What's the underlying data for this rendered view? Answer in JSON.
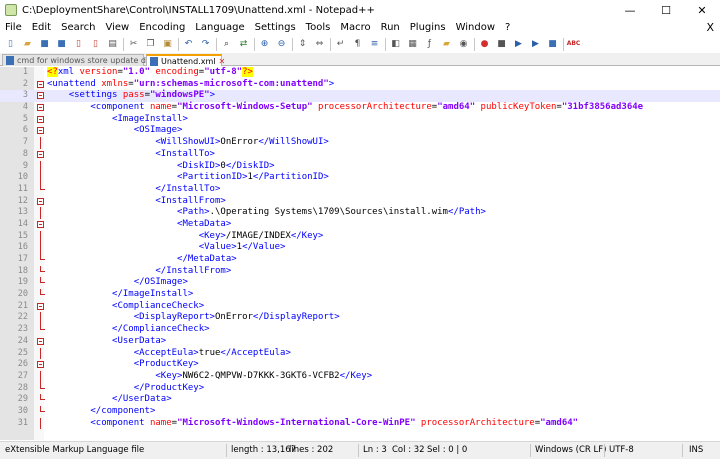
{
  "window": {
    "title": "C:\\DeploymentShare\\Control\\INSTALL1709\\Unattend.xml - Notepad++",
    "minimize_glyph": "—",
    "maximize_glyph": "☐",
    "close_glyph": "✕"
  },
  "menu": {
    "items": [
      "File",
      "Edit",
      "Search",
      "View",
      "Encoding",
      "Language",
      "Settings",
      "Tools",
      "Macro",
      "Run",
      "Plugins",
      "Window",
      "?"
    ],
    "close_glyph": "X"
  },
  "toolbar": {
    "buttons": [
      {
        "icon": "new-file-icon",
        "glyph": "▯",
        "color": "#4a7fc1"
      },
      {
        "icon": "open-file-icon",
        "glyph": "▰",
        "color": "#d8a63a"
      },
      {
        "icon": "save-icon",
        "glyph": "■",
        "color": "#3b6fb6"
      },
      {
        "icon": "save-all-icon",
        "glyph": "■",
        "color": "#3b6fb6"
      },
      {
        "icon": "close-icon",
        "glyph": "▯",
        "color": "#c8453d"
      },
      {
        "icon": "close-all-icon",
        "glyph": "▯",
        "color": "#c8453d"
      },
      {
        "icon": "print-icon",
        "glyph": "▤",
        "color": "#555555"
      },
      {
        "sep": true
      },
      {
        "icon": "cut-icon",
        "glyph": "✂",
        "color": "#555555"
      },
      {
        "icon": "copy-icon",
        "glyph": "❐",
        "color": "#555555"
      },
      {
        "icon": "paste-icon",
        "glyph": "▣",
        "color": "#b38a36"
      },
      {
        "sep": true
      },
      {
        "icon": "undo-icon",
        "glyph": "↶",
        "color": "#2b5fa8"
      },
      {
        "icon": "redo-icon",
        "glyph": "↷",
        "color": "#2b5fa8"
      },
      {
        "sep": true
      },
      {
        "icon": "find-icon",
        "glyph": "⌕",
        "color": "#333333"
      },
      {
        "icon": "replace-icon",
        "glyph": "⇄",
        "color": "#2f7d32"
      },
      {
        "sep": true
      },
      {
        "icon": "zoom-in-icon",
        "glyph": "⊕",
        "color": "#2b5fa8"
      },
      {
        "icon": "zoom-out-icon",
        "glyph": "⊖",
        "color": "#2b5fa8"
      },
      {
        "sep": true
      },
      {
        "icon": "sync-vertical-icon",
        "glyph": "⇕",
        "color": "#555555"
      },
      {
        "icon": "sync-horizontal-icon",
        "glyph": "⇔",
        "color": "#555555"
      },
      {
        "sep": true
      },
      {
        "icon": "word-wrap-icon",
        "glyph": "↵",
        "color": "#555555"
      },
      {
        "icon": "show-all-chars-icon",
        "glyph": "¶",
        "color": "#555555"
      },
      {
        "icon": "indent-guide-icon",
        "glyph": "≡",
        "color": "#2b5fa8"
      },
      {
        "sep": true
      },
      {
        "icon": "user-language-icon",
        "glyph": "◧",
        "color": "#555555"
      },
      {
        "icon": "doc-map-icon",
        "glyph": "▦",
        "color": "#555555"
      },
      {
        "icon": "function-list-icon",
        "glyph": "ƒ",
        "color": "#555555"
      },
      {
        "icon": "folder-workspace-icon",
        "glyph": "▰",
        "color": "#d8a63a"
      },
      {
        "icon": "monitoring-icon",
        "glyph": "◉",
        "color": "#555555"
      },
      {
        "sep": true
      },
      {
        "icon": "record-macro-icon",
        "glyph": "●",
        "color": "#d32f2f"
      },
      {
        "icon": "stop-record-icon",
        "glyph": "■",
        "color": "#555555"
      },
      {
        "icon": "play-macro-icon",
        "glyph": "▶",
        "color": "#2b5fa8"
      },
      {
        "icon": "run-macro-multiple-icon",
        "glyph": "▶",
        "color": "#2b5fa8"
      },
      {
        "icon": "save-macro-icon",
        "glyph": "■",
        "color": "#3b6fb6"
      },
      {
        "sep": true
      },
      {
        "icon": "spell-check-icon",
        "glyph": "ABC",
        "color": "#c62828"
      }
    ]
  },
  "tabs": [
    {
      "label": "cmd for windows store update disable.txt",
      "active": false
    },
    {
      "label": "Unattend.xml",
      "active": true
    }
  ],
  "editor": {
    "current_line": 3,
    "lines": [
      {
        "n": "1",
        "fold": "none",
        "segs": [
          [
            "decl",
            "<?"
          ],
          [
            "tag",
            "xml "
          ],
          [
            "attr",
            "version"
          ],
          [
            "text",
            "="
          ],
          [
            "val",
            "\"1.0\""
          ],
          [
            "text",
            " "
          ],
          [
            "attr",
            "encoding"
          ],
          [
            "text",
            "="
          ],
          [
            "val",
            "\"utf-8\""
          ],
          [
            "decl",
            "?>"
          ]
        ]
      },
      {
        "n": "2",
        "fold": "box",
        "segs": [
          [
            "tag",
            "<unattend "
          ],
          [
            "attr",
            "xmlns"
          ],
          [
            "text",
            "="
          ],
          [
            "val",
            "\"urn:schemas-microsoft-com:unattend\""
          ],
          [
            "tag",
            ">"
          ]
        ]
      },
      {
        "n": "3",
        "fold": "box",
        "segs": [
          [
            "text",
            "    "
          ],
          [
            "tag",
            "<settings "
          ],
          [
            "attr",
            "pass"
          ],
          [
            "text",
            "="
          ],
          [
            "val",
            "\"windowsPE\""
          ],
          [
            "tag",
            ">"
          ]
        ]
      },
      {
        "n": "4",
        "fold": "box",
        "segs": [
          [
            "text",
            "        "
          ],
          [
            "tag",
            "<component "
          ],
          [
            "attr",
            "name"
          ],
          [
            "text",
            "="
          ],
          [
            "val",
            "\"Microsoft-Windows-Setup\""
          ],
          [
            "text",
            " "
          ],
          [
            "attr",
            "processorArchitecture"
          ],
          [
            "text",
            "="
          ],
          [
            "val",
            "\"amd64\""
          ],
          [
            "text",
            " "
          ],
          [
            "attr",
            "publicKeyToken"
          ],
          [
            "text",
            "="
          ],
          [
            "val",
            "\"31bf3856ad364e"
          ]
        ]
      },
      {
        "n": "5",
        "fold": "box",
        "segs": [
          [
            "text",
            "            "
          ],
          [
            "tag",
            "<ImageInstall>"
          ]
        ]
      },
      {
        "n": "6",
        "fold": "box",
        "segs": [
          [
            "text",
            "                "
          ],
          [
            "tag",
            "<OSImage>"
          ]
        ]
      },
      {
        "n": "7",
        "fold": "vline",
        "segs": [
          [
            "text",
            "                    "
          ],
          [
            "tag",
            "<WillShowUI>"
          ],
          [
            "text",
            "OnError"
          ],
          [
            "tag",
            "</WillShowUI>"
          ]
        ]
      },
      {
        "n": "8",
        "fold": "box",
        "segs": [
          [
            "text",
            "                    "
          ],
          [
            "tag",
            "<InstallTo>"
          ]
        ]
      },
      {
        "n": "9",
        "fold": "vline",
        "segs": [
          [
            "text",
            "                        "
          ],
          [
            "tag",
            "<DiskID>"
          ],
          [
            "text",
            "0"
          ],
          [
            "tag",
            "</DiskID>"
          ]
        ]
      },
      {
        "n": "10",
        "fold": "vline",
        "segs": [
          [
            "text",
            "                        "
          ],
          [
            "tag",
            "<PartitionID>"
          ],
          [
            "text",
            "1"
          ],
          [
            "tag",
            "</PartitionID>"
          ]
        ]
      },
      {
        "n": "11",
        "fold": "end",
        "segs": [
          [
            "text",
            "                    "
          ],
          [
            "tag",
            "</InstallTo>"
          ]
        ]
      },
      {
        "n": "12",
        "fold": "box",
        "segs": [
          [
            "text",
            "                    "
          ],
          [
            "tag",
            "<InstallFrom>"
          ]
        ]
      },
      {
        "n": "13",
        "fold": "vline",
        "segs": [
          [
            "text",
            "                        "
          ],
          [
            "tag",
            "<Path>"
          ],
          [
            "text",
            ".\\Operating Systems\\1709\\Sources\\install.wim"
          ],
          [
            "tag",
            "</Path>"
          ]
        ]
      },
      {
        "n": "14",
        "fold": "box",
        "segs": [
          [
            "text",
            "                        "
          ],
          [
            "tag",
            "<MetaData>"
          ]
        ]
      },
      {
        "n": "15",
        "fold": "vline",
        "segs": [
          [
            "text",
            "                            "
          ],
          [
            "tag",
            "<Key>"
          ],
          [
            "text",
            "/IMAGE/INDEX"
          ],
          [
            "tag",
            "</Key>"
          ]
        ]
      },
      {
        "n": "16",
        "fold": "vline",
        "segs": [
          [
            "text",
            "                            "
          ],
          [
            "tag",
            "<Value>"
          ],
          [
            "text",
            "1"
          ],
          [
            "tag",
            "</Value>"
          ]
        ]
      },
      {
        "n": "17",
        "fold": "end",
        "segs": [
          [
            "text",
            "                        "
          ],
          [
            "tag",
            "</MetaData>"
          ]
        ]
      },
      {
        "n": "18",
        "fold": "end",
        "segs": [
          [
            "text",
            "                    "
          ],
          [
            "tag",
            "</InstallFrom>"
          ]
        ]
      },
      {
        "n": "19",
        "fold": "end",
        "segs": [
          [
            "text",
            "                "
          ],
          [
            "tag",
            "</OSImage>"
          ]
        ]
      },
      {
        "n": "20",
        "fold": "end",
        "segs": [
          [
            "text",
            "            "
          ],
          [
            "tag",
            "</ImageInstall>"
          ]
        ]
      },
      {
        "n": "21",
        "fold": "box",
        "segs": [
          [
            "text",
            "            "
          ],
          [
            "tag",
            "<ComplianceCheck>"
          ]
        ]
      },
      {
        "n": "22",
        "fold": "vline",
        "segs": [
          [
            "text",
            "                "
          ],
          [
            "tag",
            "<DisplayReport>"
          ],
          [
            "text",
            "OnError"
          ],
          [
            "tag",
            "</DisplayReport>"
          ]
        ]
      },
      {
        "n": "23",
        "fold": "end",
        "segs": [
          [
            "text",
            "            "
          ],
          [
            "tag",
            "</ComplianceCheck>"
          ]
        ]
      },
      {
        "n": "24",
        "fold": "box",
        "segs": [
          [
            "text",
            "            "
          ],
          [
            "tag",
            "<UserData>"
          ]
        ]
      },
      {
        "n": "25",
        "fold": "vline",
        "segs": [
          [
            "text",
            "                "
          ],
          [
            "tag",
            "<AcceptEula>"
          ],
          [
            "text",
            "true"
          ],
          [
            "tag",
            "</AcceptEula>"
          ]
        ]
      },
      {
        "n": "26",
        "fold": "box",
        "segs": [
          [
            "text",
            "                "
          ],
          [
            "tag",
            "<ProductKey>"
          ]
        ]
      },
      {
        "n": "27",
        "fold": "vline",
        "segs": [
          [
            "text",
            "                    "
          ],
          [
            "tag",
            "<Key>"
          ],
          [
            "text",
            "NW6C2-QMPVW-D7KKK-3GKT6-VCFB2"
          ],
          [
            "tag",
            "</Key>"
          ]
        ]
      },
      {
        "n": "28",
        "fold": "end",
        "segs": [
          [
            "text",
            "                "
          ],
          [
            "tag",
            "</ProductKey>"
          ]
        ]
      },
      {
        "n": "29",
        "fold": "end",
        "segs": [
          [
            "text",
            "            "
          ],
          [
            "tag",
            "</UserData>"
          ]
        ]
      },
      {
        "n": "30",
        "fold": "end",
        "segs": [
          [
            "text",
            "        "
          ],
          [
            "tag",
            "</component>"
          ]
        ]
      },
      {
        "n": "31",
        "fold": "vline",
        "segs": [
          [
            "text",
            "        "
          ],
          [
            "tag",
            "<component "
          ],
          [
            "attr",
            "name"
          ],
          [
            "text",
            "="
          ],
          [
            "val",
            "\"Microsoft-Windows-International-Core-WinPE\""
          ],
          [
            "text",
            " "
          ],
          [
            "attr",
            "processorArchitecture"
          ],
          [
            "text",
            "="
          ],
          [
            "val",
            "\"amd64\""
          ]
        ]
      }
    ]
  },
  "status": {
    "file_type": "eXtensible Markup Language file",
    "length": "length : 13,167",
    "lines": "lines : 202",
    "ln": "Ln : 3",
    "col": "Col : 32",
    "sel": "Sel : 0 | 0",
    "eol": "Windows (CR LF)",
    "encoding": "UTF-8",
    "mode": "INS"
  }
}
